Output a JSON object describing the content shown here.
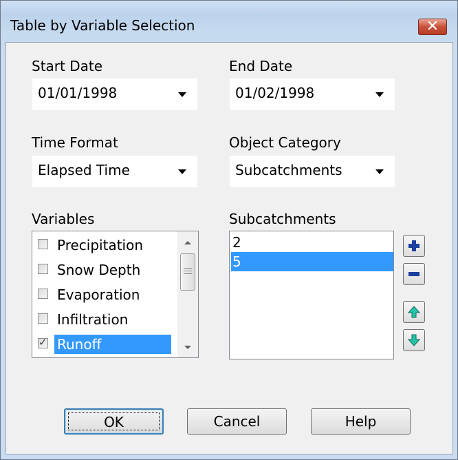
{
  "window": {
    "title": "Table by Variable Selection",
    "close_symbol": "✕"
  },
  "start_date": {
    "label": "Start Date",
    "value": "01/01/1998"
  },
  "end_date": {
    "label": "End Date",
    "value": "01/02/1998"
  },
  "time_format": {
    "label": "Time Format",
    "value": "Elapsed Time"
  },
  "object_category": {
    "label": "Object Category",
    "value": "Subcatchments"
  },
  "variables": {
    "label": "Variables",
    "items": [
      {
        "label": "Precipitation",
        "checked": false,
        "selected": false
      },
      {
        "label": "Snow Depth",
        "checked": false,
        "selected": false
      },
      {
        "label": "Evaporation",
        "checked": false,
        "selected": false
      },
      {
        "label": "Infiltration",
        "checked": false,
        "selected": false
      },
      {
        "label": "Runoff",
        "checked": true,
        "selected": true
      }
    ]
  },
  "objects": {
    "label": "Subcatchments",
    "items": [
      {
        "label": "2",
        "selected": false
      },
      {
        "label": "5",
        "selected": true
      }
    ]
  },
  "side_buttons": [
    "plus-icon",
    "minus-icon",
    "arrow-up-icon",
    "arrow-down-icon"
  ],
  "buttons": {
    "ok": "OK",
    "cancel": "Cancel",
    "help": "Help"
  },
  "colors": {
    "selection": "#3399ff",
    "close_button": "#c8513a",
    "dialog_bg": "#f0f0f0"
  }
}
